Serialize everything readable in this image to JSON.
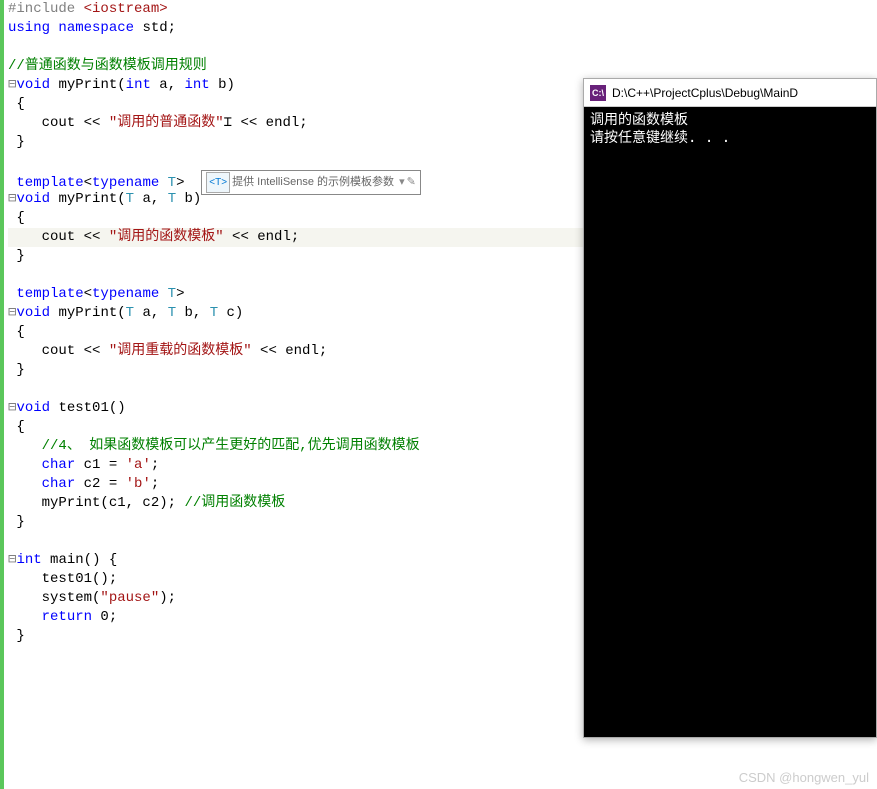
{
  "code": {
    "preprocessor": "#include",
    "include_header": " <iostream>",
    "using": "using",
    "namespace": "namespace",
    "std_stmt": " std;",
    "comment_rules": "//普通函数与函数模板调用规则",
    "void": "void",
    "int": "int",
    "char": "char",
    "return": "return",
    "template": "template",
    "typename": "typename",
    "T": "T",
    "myPrint": " myPrint",
    "func_test01": " test01",
    "main": " main",
    "params_int": "(int a, int b)",
    "params_T2": "(T a, T b)",
    "params_T3": "(T a, T b, T c)",
    "empty_params": "()",
    "brace_open": "{",
    "brace_close": "}",
    "cout_line": "    cout << ",
    "endl_line": " << endl;",
    "str_normal": "\"调用的普通函数\"",
    "str_template": "\"调用的函数模板\"",
    "str_overload": "\"调用重载的函数模板\"",
    "str_pause": "\"pause\"",
    "comment_4": "//4、 如果函数模板可以产生更好的匹配,优先调用函数模板",
    "c1_decl": " c1 = ",
    "c2_decl": " c2 = ",
    "char_a": "'a'",
    "char_b": "'b'",
    "semicolon": ";",
    "myPrint_call": "    myPrint(c1, c2); ",
    "comment_call_template": "//调用函数模板",
    "test01_call": "    test01();",
    "system_call": "    system(",
    "return_0": " 0;",
    "space_brace": " {"
  },
  "intellisense": {
    "icon_text": "<T>",
    "tooltip_text": "提供 IntelliSense 的示例模板参数",
    "dropdown": "▾",
    "pen": "✎"
  },
  "console": {
    "title": "D:\\C++\\ProjectCplus\\Debug\\MainD",
    "icon_text": "C:\\",
    "line1": "调用的函数模板",
    "line2": "请按任意键继续. . ."
  },
  "watermark": "CSDN @hongwen_yul"
}
